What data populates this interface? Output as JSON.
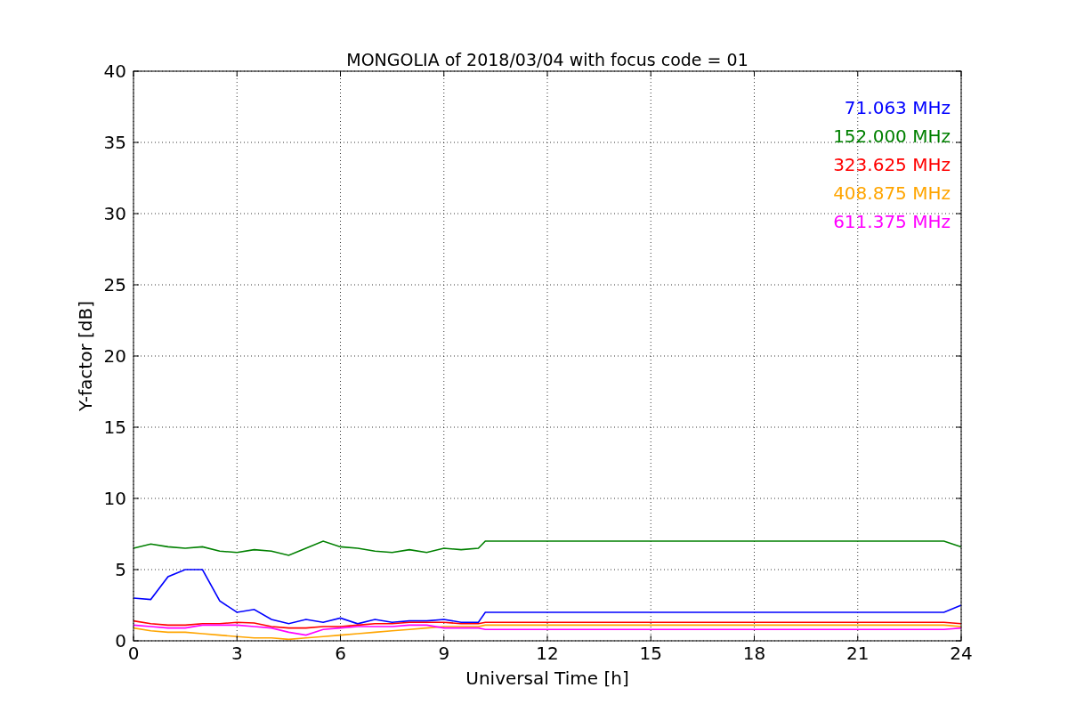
{
  "chart_data": {
    "type": "line",
    "title": "MONGOLIA of 2018/03/04 with focus code = 01",
    "xlabel": "Universal Time [h]",
    "ylabel": "Y-factor [dB]",
    "x": [
      0,
      0.5,
      1,
      1.5,
      2,
      2.5,
      3,
      3.5,
      4,
      4.5,
      5,
      5.5,
      6,
      6.5,
      7,
      7.5,
      8,
      8.5,
      9,
      9.5,
      10,
      10.2,
      23.5,
      24
    ],
    "series": [
      {
        "name": "71.063 MHz",
        "color": "#0000ff",
        "values": [
          3.0,
          2.9,
          4.5,
          5.0,
          5.0,
          2.8,
          2.0,
          2.2,
          1.5,
          1.2,
          1.5,
          1.3,
          1.6,
          1.2,
          1.5,
          1.3,
          1.4,
          1.4,
          1.5,
          1.3,
          1.3,
          2.0,
          2.0,
          2.5
        ]
      },
      {
        "name": "152.000 MHz",
        "color": "#008000",
        "values": [
          6.5,
          6.8,
          6.6,
          6.5,
          6.6,
          6.3,
          6.2,
          6.4,
          6.3,
          6.0,
          6.5,
          7.0,
          6.6,
          6.5,
          6.3,
          6.2,
          6.4,
          6.2,
          6.5,
          6.4,
          6.5,
          7.0,
          7.0,
          6.6
        ]
      },
      {
        "name": "323.625 MHz",
        "color": "#ff0000",
        "values": [
          1.4,
          1.2,
          1.1,
          1.1,
          1.2,
          1.2,
          1.3,
          1.25,
          1.0,
          0.9,
          0.9,
          1.0,
          1.0,
          1.1,
          1.2,
          1.2,
          1.3,
          1.3,
          1.3,
          1.2,
          1.2,
          1.3,
          1.3,
          1.2
        ]
      },
      {
        "name": "408.875 MHz",
        "color": "#ffa500",
        "values": [
          0.9,
          0.7,
          0.6,
          0.6,
          0.5,
          0.4,
          0.3,
          0.2,
          0.2,
          0.1,
          0.2,
          0.3,
          0.4,
          0.5,
          0.6,
          0.7,
          0.8,
          0.9,
          1.0,
          1.0,
          1.0,
          1.1,
          1.1,
          1.0
        ]
      },
      {
        "name": "611.375 MHz",
        "color": "#ff00ff",
        "values": [
          1.1,
          1.0,
          0.9,
          0.9,
          1.1,
          1.1,
          1.1,
          1.0,
          0.9,
          0.6,
          0.4,
          0.8,
          0.9,
          1.0,
          1.0,
          1.0,
          1.1,
          1.1,
          0.9,
          0.9,
          0.9,
          0.8,
          0.8,
          0.9
        ]
      }
    ],
    "grid": true,
    "xlim": [
      0,
      24
    ],
    "ylim": [
      0,
      40
    ],
    "xticks": [
      0,
      3,
      6,
      9,
      12,
      15,
      18,
      21,
      24
    ],
    "yticks": [
      0,
      5,
      10,
      15,
      20,
      25,
      30,
      35,
      40
    ]
  }
}
